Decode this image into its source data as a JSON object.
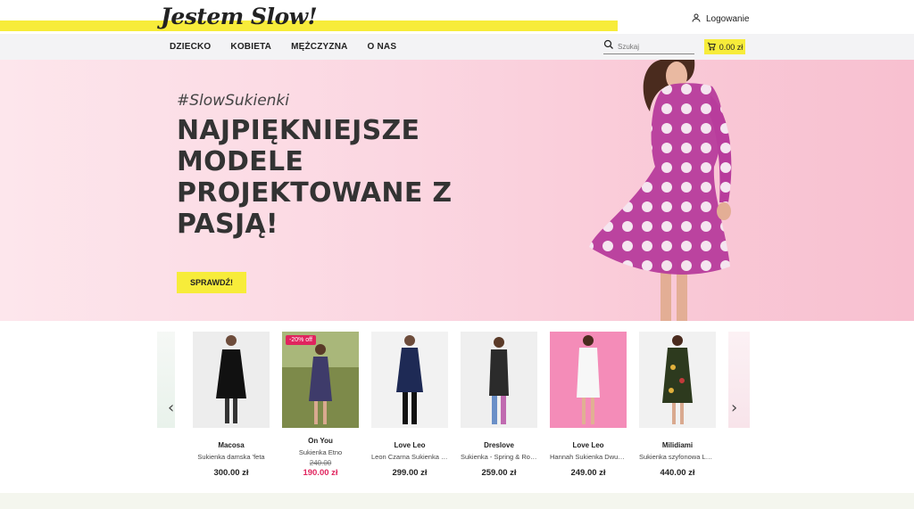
{
  "brand": {
    "logo_text": "Jestem Slow!"
  },
  "header": {
    "login_label": "Logowanie",
    "nav": [
      "DZIECKO",
      "KOBIETA",
      "MĘŻCZYZNA",
      "O NAS"
    ],
    "search_placeholder": "Szukaj",
    "cart_total": "0.00 zł"
  },
  "hero": {
    "hashtag": "#SlowSukienki",
    "headline": "NAJPIĘKNIEJSZE MODELE PROJEKTOWANE Z PASJĄ!",
    "cta_label": "SPRAWDŹ!"
  },
  "colors": {
    "accent": "#f7ec3a",
    "sale": "#e0245e",
    "hero_bg": "#fbd6e1"
  },
  "products": [
    {
      "brand": "Macosa",
      "name": "Sukienka damska 'feta",
      "price": "300.00 zł",
      "old_price": "",
      "badge": ""
    },
    {
      "brand": "On You",
      "name": "Sukienka Etno",
      "price": "190.00 zł",
      "old_price": "240.00",
      "badge": "-20% off"
    },
    {
      "brand": "Love Leo",
      "name": "Leon Czarna Sukienka w...",
      "price": "299.00 zł",
      "old_price": "",
      "badge": ""
    },
    {
      "brand": "Dreslove",
      "name": "Sukienka - Spring & Roll ...",
      "price": "259.00 zł",
      "old_price": "",
      "badge": ""
    },
    {
      "brand": "Love Leo",
      "name": "Hannah Sukienka Dwus...",
      "price": "249.00 zł",
      "old_price": "",
      "badge": ""
    },
    {
      "brand": "Milidiami",
      "name": "Sukienka szyfonowa Lau...",
      "price": "440.00 zł",
      "old_price": "",
      "badge": ""
    }
  ],
  "icons": {
    "user": "user-icon",
    "search": "search-icon",
    "cart": "cart-icon",
    "prev": "chevron-left-icon",
    "next": "chevron-right-icon"
  }
}
